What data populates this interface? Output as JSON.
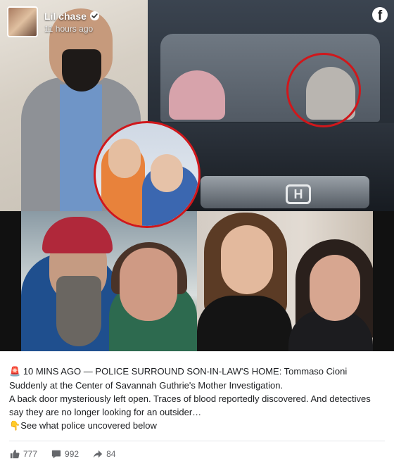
{
  "post": {
    "author": "Lil chase",
    "timestamp": "11 hours ago",
    "verified": true,
    "platform_logo": "f",
    "caption": {
      "line1_emoji": "🚨",
      "line1": "10 MINS AGO — POLICE SURROUND SON-IN-LAW'S HOME: Tommaso Cioni Suddenly at the Center of Savannah Guthrie's Mother Investigation.",
      "line2": "A back door mysteriously left open. Traces of blood reportedly discovered. And detectives say they are no longer looking for an outsider…",
      "line3_emoji": "👇",
      "line3": "See what police uncovered below"
    },
    "stats": {
      "likes": "777",
      "comments": "992",
      "shares": "84"
    },
    "media": {
      "car_badge": "H"
    }
  },
  "colors": {
    "highlight_ring": "#d0171b",
    "text_primary": "#1c1e21",
    "text_secondary": "#65676b"
  },
  "icons": {
    "verified": "verified-badge-icon",
    "facebook": "facebook-logo-icon",
    "like": "thumbs-up-icon",
    "comment": "comment-bubble-icon",
    "share": "share-arrow-icon"
  }
}
